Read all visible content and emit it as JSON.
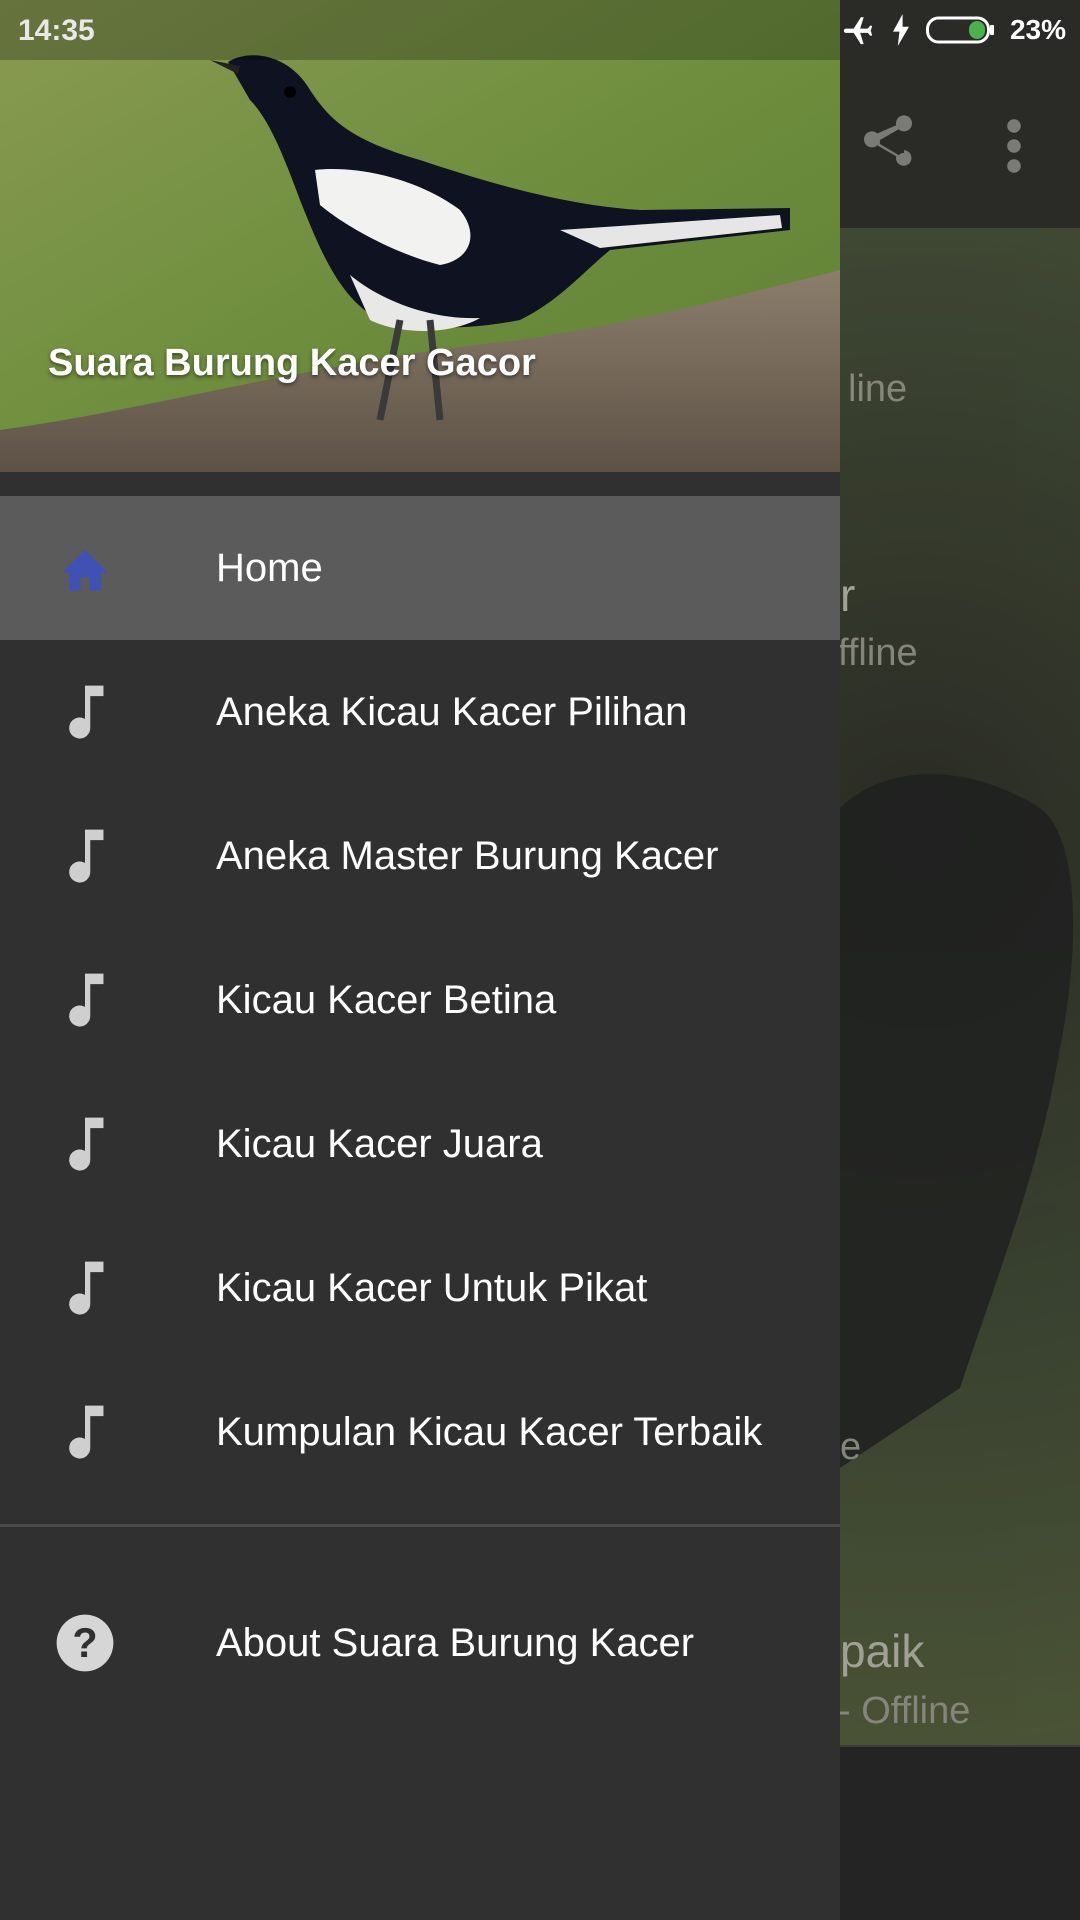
{
  "status_bar": {
    "time": "14:35",
    "battery_percent": "23%",
    "icons": [
      "airplane-mode-icon",
      "charging-bolt-icon",
      "battery-icon"
    ]
  },
  "background_app": {
    "toolbar_icons": [
      "share-icon",
      "more-vert-icon"
    ],
    "partial_texts": [
      "line",
      "r",
      "ffline",
      "e",
      "paik",
      "- Offline"
    ]
  },
  "drawer": {
    "header_title": "Suara Burung Kacer Gacor",
    "menu_items": [
      {
        "label": "Home",
        "icon": "home-icon",
        "active": true
      },
      {
        "label": "Aneka Kicau Kacer Pilihan",
        "icon": "music-note-icon"
      },
      {
        "label": "Aneka Master Burung Kacer",
        "icon": "music-note-icon"
      },
      {
        "label": "Kicau Kacer Betina",
        "icon": "music-note-icon"
      },
      {
        "label": "Kicau Kacer Juara",
        "icon": "music-note-icon"
      },
      {
        "label": "Kicau Kacer Untuk Pikat",
        "icon": "music-note-icon"
      },
      {
        "label": "Kumpulan Kicau Kacer Terbaik",
        "icon": "music-note-icon"
      }
    ],
    "about_item": {
      "label": "About Suara Burung Kacer",
      "icon": "help-icon"
    }
  },
  "colors": {
    "drawer_bg": "#303030",
    "active_item_bg": "#5b5b5b",
    "home_icon": "#3f51b5",
    "menu_icon": "#cfcfcf",
    "battery_fill": "#4caf50"
  }
}
